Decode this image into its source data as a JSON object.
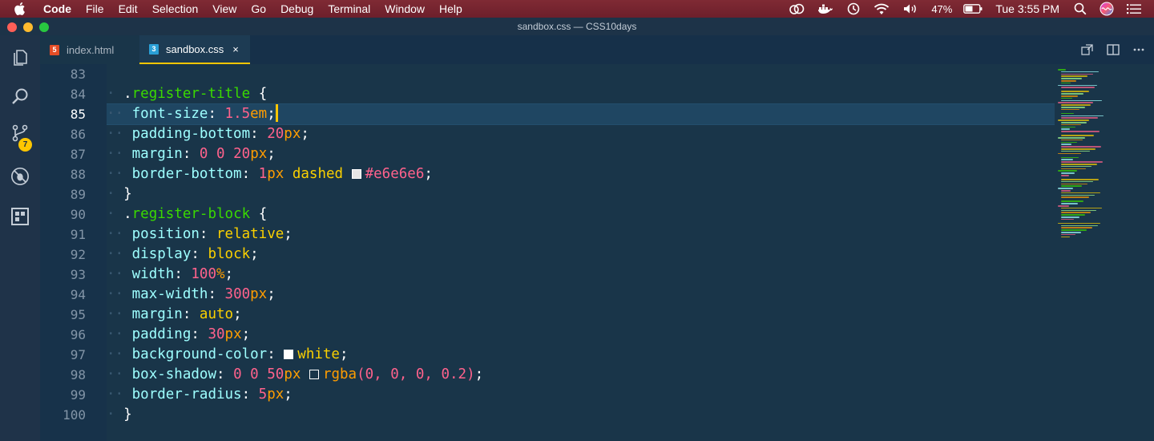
{
  "menubar": {
    "app_name": "Code",
    "items": [
      "File",
      "Edit",
      "Selection",
      "View",
      "Go",
      "Debug",
      "Terminal",
      "Window",
      "Help"
    ],
    "battery": "47%",
    "clock": "Tue 3:55 PM"
  },
  "window": {
    "title": "sandbox.css — CSS10days"
  },
  "activity_bar": {
    "scm_badge": "7"
  },
  "tabs": [
    {
      "label": "index.html",
      "icon": "html5-icon",
      "active": false
    },
    {
      "label": "sandbox.css",
      "icon": "css3-icon",
      "active": true,
      "close": "×"
    }
  ],
  "editor": {
    "current_line": 85,
    "lines": [
      {
        "n": "83"
      },
      {
        "n": "84",
        "sel": ".register-title",
        "open": " {"
      },
      {
        "n": "85",
        "prop": "font-size",
        "num": "1.5",
        "unit": "em"
      },
      {
        "n": "86",
        "prop": "padding-bottom",
        "num": "20",
        "unit": "px"
      },
      {
        "n": "87",
        "prop": "margin",
        "num_a": "0",
        "num_b": "0",
        "num_c": "20",
        "unit": "px"
      },
      {
        "n": "88",
        "prop": "border-bottom",
        "num": "1",
        "unit": "px",
        "kw": "dashed",
        "color_text": "#e6e6e6",
        "swatch": "#e6e6e6"
      },
      {
        "n": "89",
        "close": "}"
      },
      {
        "n": "90",
        "sel": ".register-block",
        "open": " {"
      },
      {
        "n": "91",
        "prop": "position",
        "kw": "relative"
      },
      {
        "n": "92",
        "prop": "display",
        "kw": "block"
      },
      {
        "n": "93",
        "prop": "width",
        "num": "100",
        "unit": "%"
      },
      {
        "n": "94",
        "prop": "max-width",
        "num": "300",
        "unit": "px"
      },
      {
        "n": "95",
        "prop": "margin",
        "kw": "auto"
      },
      {
        "n": "96",
        "prop": "padding",
        "num": "30",
        "unit": "px"
      },
      {
        "n": "97",
        "prop": "background-color",
        "kw": "white",
        "swatch": "#ffffff"
      },
      {
        "n": "98",
        "prop": "box-shadow",
        "num_a": "0",
        "num_b": "0",
        "num_c": "50",
        "unit": "px",
        "fn": "rgba",
        "args": "(0, 0, 0, 0.2)",
        "swatch": "#000000"
      },
      {
        "n": "99",
        "prop": "border-radius",
        "num": "5",
        "unit": "px"
      },
      {
        "n": "100",
        "close": "}"
      }
    ]
  },
  "colors": {
    "accent": "#ffc600",
    "editor_bg": "#193549",
    "selector": "#3ad900",
    "property": "#9effff",
    "number": "#ff628c",
    "unit": "#ff9d00",
    "keyword": "#fad000"
  }
}
